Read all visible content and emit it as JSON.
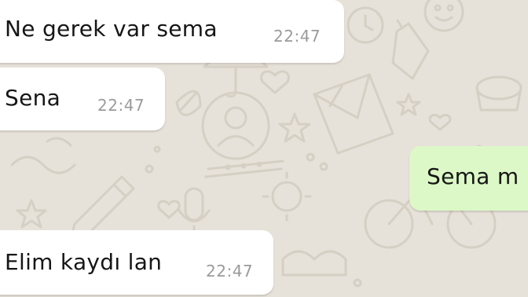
{
  "chat": {
    "messages": [
      {
        "direction": "incoming",
        "text": "Ne gerek var sema",
        "time": "22:47"
      },
      {
        "direction": "incoming",
        "text": "Sena",
        "time": "22:47"
      },
      {
        "direction": "outgoing",
        "text": "Sema m"
      },
      {
        "direction": "incoming",
        "text": "Elim kaydı lan",
        "time": "22:47"
      }
    ]
  },
  "colors": {
    "wallpaper": "#e7e2d9",
    "doodle": "#d6d0c6",
    "incoming_bubble": "#ffffff",
    "outgoing_bubble": "#dcf8c6",
    "timestamp": "#9b9b9b"
  }
}
